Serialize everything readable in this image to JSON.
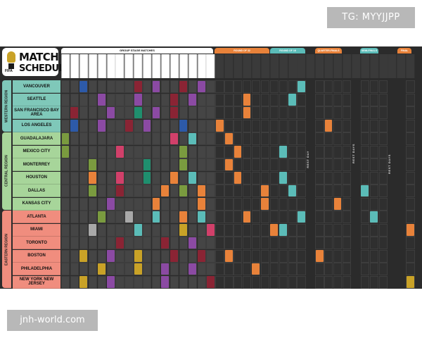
{
  "watermarks": {
    "top": "TG: MYYJJPP",
    "bottom": "jnh-world.com"
  },
  "poster": {
    "title_line1": "MATCH",
    "title_line2": "SCHEDULE",
    "fifa_mark": "FIFA",
    "group_header": "GROUP STAGE MATCHES",
    "stages": [
      "ROUND OF 32",
      "ROUND OF 16",
      "QUARTER-FINALS",
      "SEMI-FINALS",
      "FINAL"
    ],
    "regions": [
      {
        "name": "WESTERN REGION",
        "color": "#7fc8b9"
      },
      {
        "name": "CENTRAL REGION",
        "color": "#a7d59a"
      },
      {
        "name": "EASTERN REGION",
        "color": "#f08d7e"
      }
    ],
    "cities": [
      {
        "name": "VANCOUVER",
        "region": 0
      },
      {
        "name": "SEATTLE",
        "region": 0
      },
      {
        "name": "SAN FRANCISCO BAY AREA",
        "region": 0
      },
      {
        "name": "LOS ANGELES",
        "region": 0
      },
      {
        "name": "GUADALAJARA",
        "region": 1
      },
      {
        "name": "MEXICO CITY",
        "region": 1
      },
      {
        "name": "MONTERREY",
        "region": 1
      },
      {
        "name": "HOUSTON",
        "region": 1
      },
      {
        "name": "DALLAS",
        "region": 1
      },
      {
        "name": "KANSAS CITY",
        "region": 1
      },
      {
        "name": "ATLANTA",
        "region": 2
      },
      {
        "name": "MIAMI",
        "region": 2
      },
      {
        "name": "TORONTO",
        "region": 2
      },
      {
        "name": "BOSTON",
        "region": 2
      },
      {
        "name": "PHILADELPHIA",
        "region": 2
      },
      {
        "name": "NEW YORK NEW JERSEY",
        "region": 2
      }
    ],
    "rest_label": "REST DAY",
    "rest_days_label": "REST DAYS"
  }
}
